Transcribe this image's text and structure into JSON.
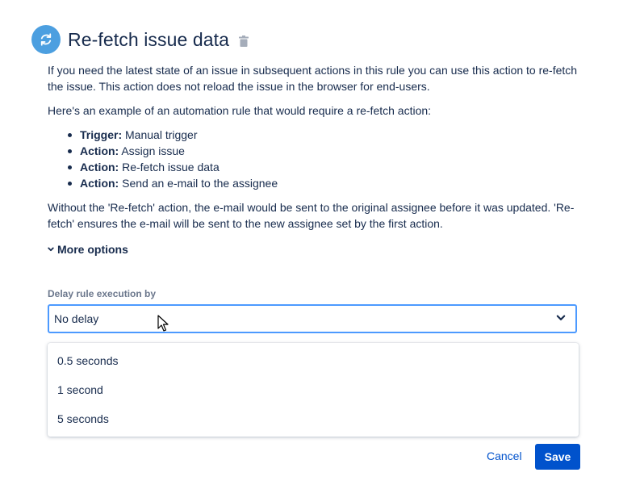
{
  "header": {
    "title": "Re-fetch issue data",
    "icon": "refresh-icon"
  },
  "description": {
    "p1": "If you need the latest state of an issue in subsequent actions in this rule you can use this action to re-fetch the issue. This action does not reload the issue in the browser for end-users.",
    "p2": "Here's an example of an automation rule that would require a re-fetch action:",
    "bullets": [
      {
        "label": "Trigger:",
        "text": " Manual trigger"
      },
      {
        "label": "Action:",
        "text": " Assign issue"
      },
      {
        "label": "Action:",
        "text": " Re-fetch issue data"
      },
      {
        "label": "Action:",
        "text": " Send an e-mail to the assignee"
      }
    ],
    "p3": "Without the 'Re-fetch' action, the e-mail would be sent to the original assignee before it was updated. 'Re-fetch' ensures the e-mail will be sent to the new assignee set by the first action."
  },
  "more_options": {
    "label": "More options"
  },
  "delay": {
    "label": "Delay rule execution by",
    "selected": "No delay",
    "options": [
      "0.5 seconds",
      "1 second",
      "5 seconds"
    ]
  },
  "footer": {
    "cancel_label": "Cancel",
    "save_label": "Save"
  },
  "colors": {
    "accent": "#0052cc",
    "icon_bg": "#4c9fe0",
    "focus_border": "#4c9aff",
    "text": "#172b4d",
    "muted": "#6b778c"
  }
}
